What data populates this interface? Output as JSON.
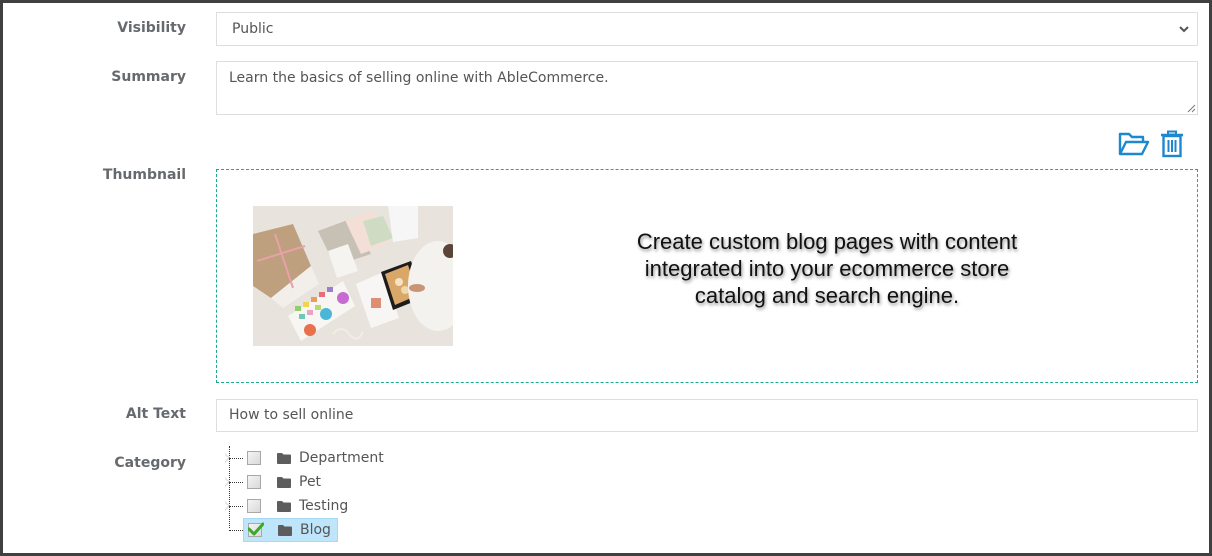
{
  "form": {
    "visibility": {
      "label": "Visibility",
      "value": "Public"
    },
    "summary": {
      "label": "Summary",
      "value": "Learn the basics of selling online with AbleCommerce."
    },
    "thumbnail": {
      "label": "Thumbnail",
      "actions": [
        {
          "icon": "folder-open-icon",
          "name": "browse-thumbnail-button"
        },
        {
          "icon": "trash-icon",
          "name": "delete-thumbnail-button"
        }
      ],
      "caption_lines": [
        "Create custom blog pages with content",
        "integrated into your ecommerce store",
        "catalog and search engine."
      ]
    },
    "alt_text": {
      "label": "Alt Text",
      "value": "How to sell online"
    },
    "category": {
      "label": "Category",
      "items": [
        {
          "label": "Department",
          "checked": false,
          "expandable": true
        },
        {
          "label": "Pet",
          "checked": false,
          "expandable": true
        },
        {
          "label": "Testing",
          "checked": false,
          "expandable": true
        },
        {
          "label": "Blog",
          "checked": true,
          "expandable": false
        }
      ]
    }
  },
  "colors": {
    "accent": "#1e88cf",
    "dropzone_border": "#1aab8a",
    "selected_node": "#bfe5fb",
    "label_text": "#666a6e",
    "check_green": "#3aa82a"
  }
}
